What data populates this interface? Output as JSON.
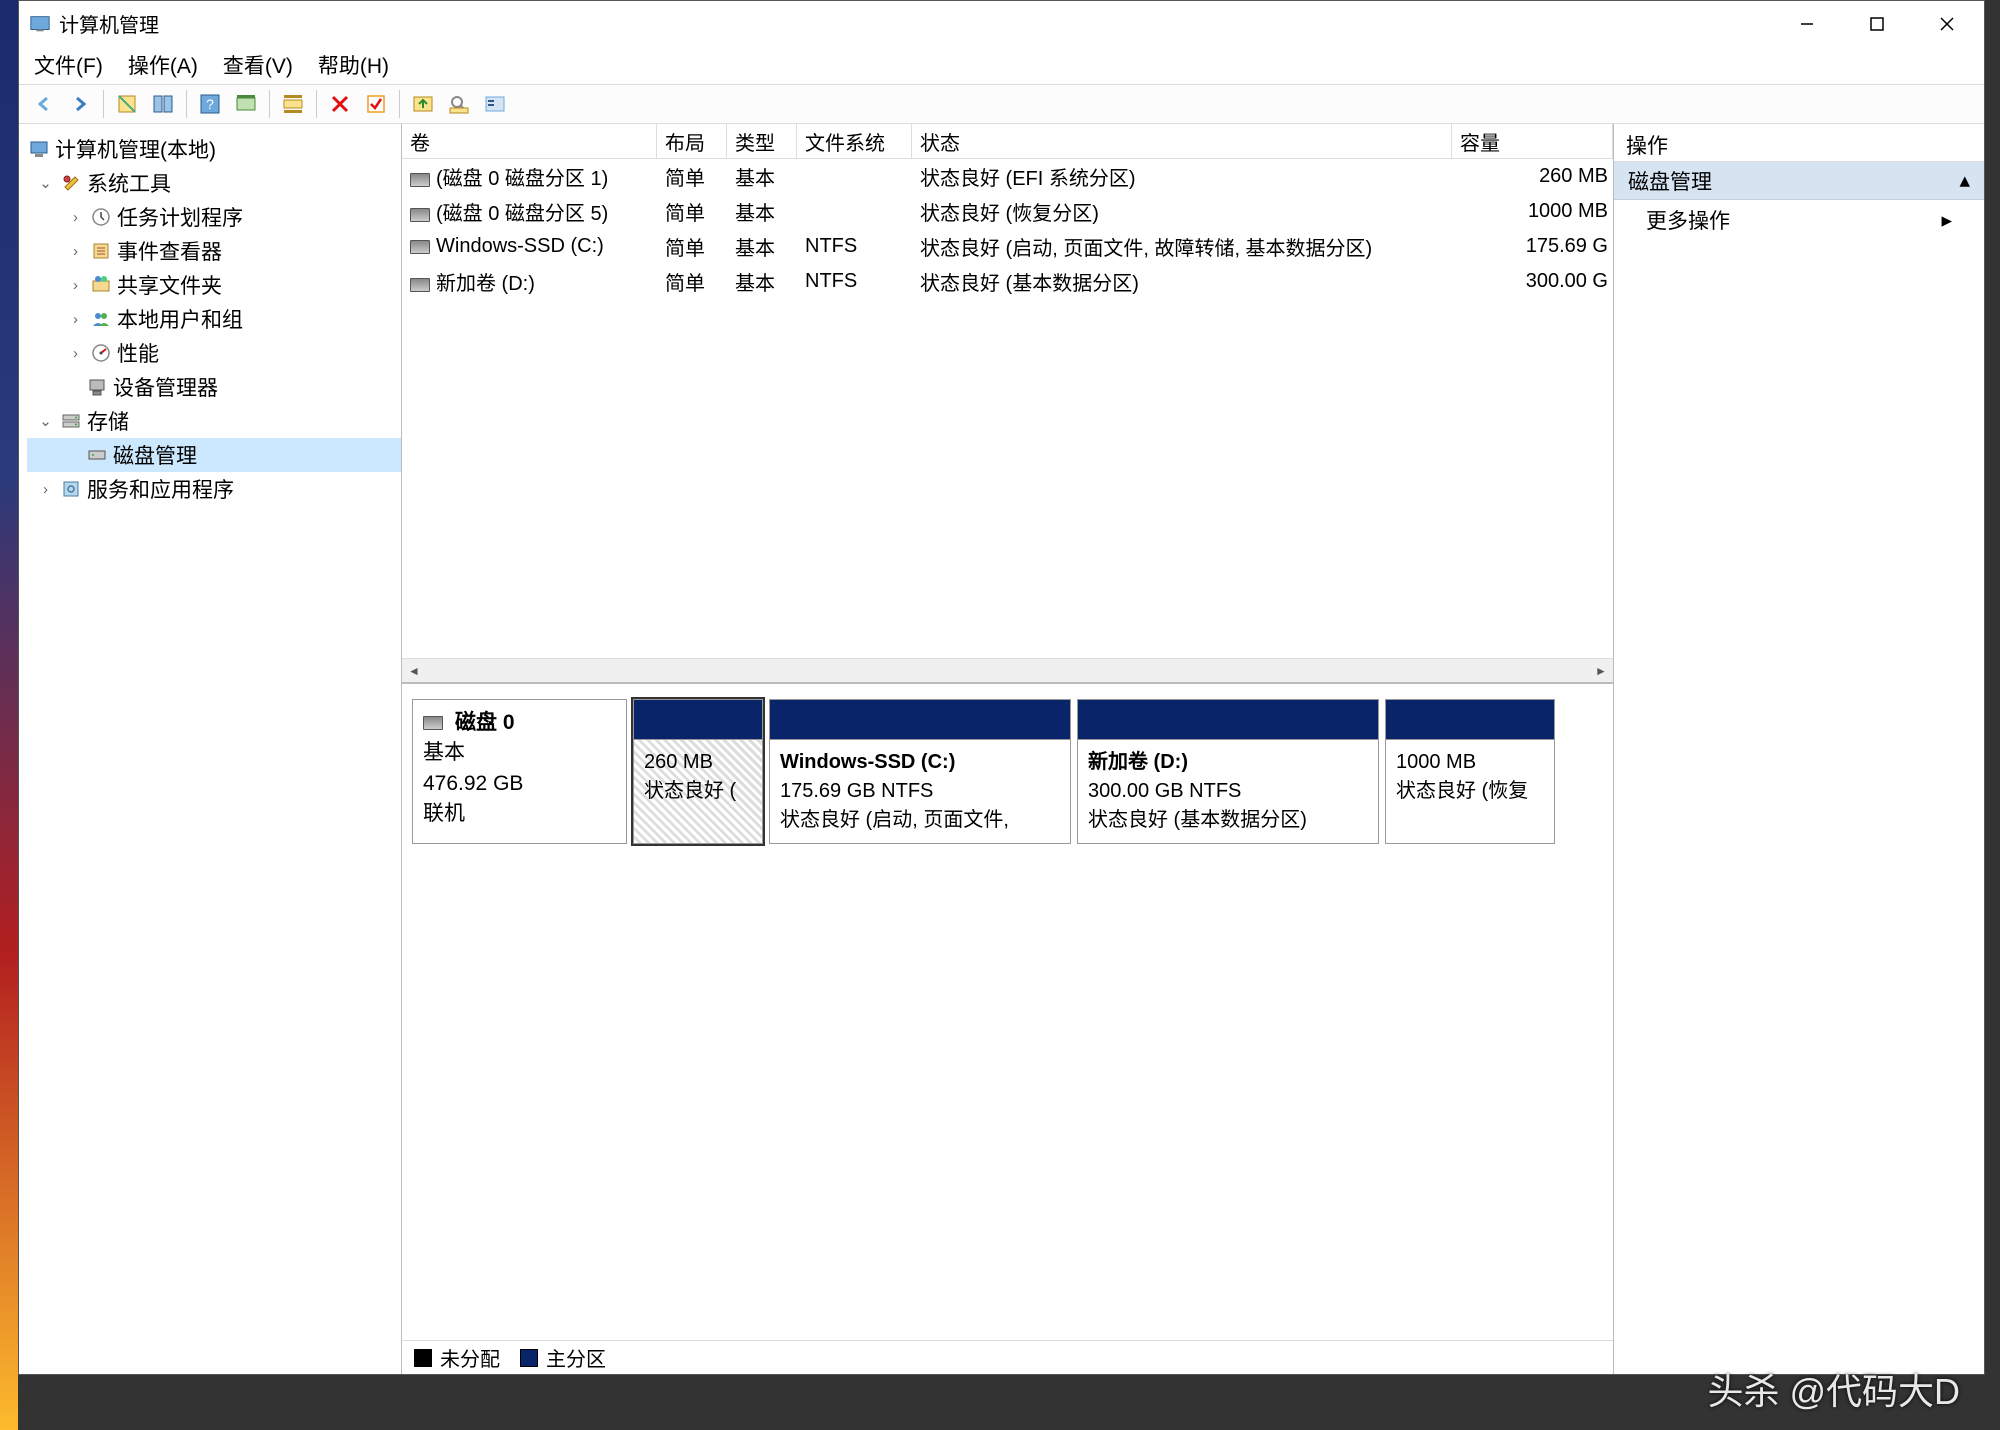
{
  "title": "计算机管理",
  "menus": {
    "file": "文件(F)",
    "action": "操作(A)",
    "view": "查看(V)",
    "help": "帮助(H)"
  },
  "tree": {
    "root": "计算机管理(本地)",
    "systools": "系统工具",
    "scheduler": "任务计划程序",
    "eventv": "事件查看器",
    "shares": "共享文件夹",
    "users": "本地用户和组",
    "perf": "性能",
    "devmgr": "设备管理器",
    "storage": "存储",
    "diskmgmt": "磁盘管理",
    "services": "服务和应用程序"
  },
  "columns": {
    "volume": "卷",
    "layout": "布局",
    "type": "类型",
    "fs": "文件系统",
    "status": "状态",
    "capacity": "容量"
  },
  "volumes": [
    {
      "name": "(磁盘 0 磁盘分区 1)",
      "layout": "简单",
      "type": "基本",
      "fs": "",
      "status": "状态良好 (EFI 系统分区)",
      "capacity": "260 MB"
    },
    {
      "name": "(磁盘 0 磁盘分区 5)",
      "layout": "简单",
      "type": "基本",
      "fs": "",
      "status": "状态良好 (恢复分区)",
      "capacity": "1000 MB"
    },
    {
      "name": "Windows-SSD (C:)",
      "layout": "简单",
      "type": "基本",
      "fs": "NTFS",
      "status": "状态良好 (启动, 页面文件, 故障转储, 基本数据分区)",
      "capacity": "175.69 G"
    },
    {
      "name": "新加卷 (D:)",
      "layout": "简单",
      "type": "基本",
      "fs": "NTFS",
      "status": "状态良好 (基本数据分区)",
      "capacity": "300.00 G"
    }
  ],
  "disk": {
    "name": "磁盘 0",
    "type": "基本",
    "size": "476.92 GB",
    "status": "联机",
    "partitions": [
      {
        "name": "",
        "size": "260 MB",
        "status": "状态良好 (",
        "widthpx": 130
      },
      {
        "name": "Windows-SSD  (C:)",
        "size": "175.69 GB NTFS",
        "status": "状态良好 (启动, 页面文件,",
        "widthpx": 302
      },
      {
        "name": "新加卷  (D:)",
        "size": "300.00 GB NTFS",
        "status": "状态良好 (基本数据分区)",
        "widthpx": 302
      },
      {
        "name": "",
        "size": "1000 MB",
        "status": "状态良好 (恢复",
        "widthpx": 170
      }
    ]
  },
  "legend": {
    "unalloc": "未分配",
    "primary": "主分区"
  },
  "actions": {
    "header": "操作",
    "sub": "磁盘管理",
    "more": "更多操作"
  },
  "watermark": "头杀 @代码大D"
}
